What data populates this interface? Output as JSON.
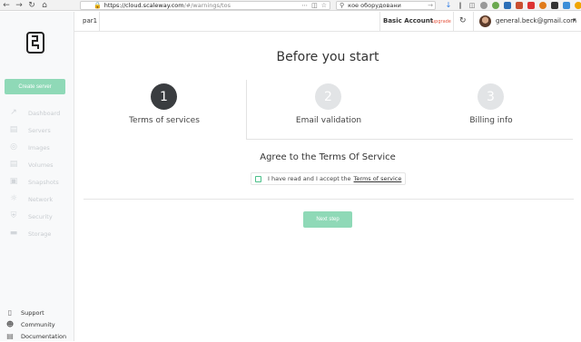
{
  "browser": {
    "url_host": "https://cloud.scaleway.com",
    "url_path": "/#/warnings/tos",
    "search_text": "кое оборудовани",
    "icons": [
      "back-icon",
      "forward-icon",
      "reload-icon",
      "home-icon",
      "download-icon",
      "library-icon",
      "sidebar-icon"
    ]
  },
  "sidebar": {
    "create_label": "Create server",
    "items": [
      {
        "label": "Dashboard",
        "icon": "chart-line-icon"
      },
      {
        "label": "Servers",
        "icon": "server-icon"
      },
      {
        "label": "Images",
        "icon": "disc-icon"
      },
      {
        "label": "Volumes",
        "icon": "volume-icon"
      },
      {
        "label": "Snapshots",
        "icon": "camera-icon"
      },
      {
        "label": "Network",
        "icon": "network-icon"
      },
      {
        "label": "Security",
        "icon": "shield-icon"
      },
      {
        "label": "Storage",
        "icon": "storage-icon"
      }
    ],
    "footer": [
      {
        "label": "Support",
        "icon": "chat-icon"
      },
      {
        "label": "Community",
        "icon": "users-icon"
      },
      {
        "label": "Documentation",
        "icon": "book-icon"
      }
    ]
  },
  "header": {
    "org": "par1",
    "account": "Basic Account",
    "upgrade": "upgrade",
    "email": "general.beck@gmail.com"
  },
  "main": {
    "title": "Before you start",
    "steps": [
      {
        "num": "1",
        "label": "Terms of services"
      },
      {
        "num": "2",
        "label": "Email validation"
      },
      {
        "num": "3",
        "label": "Billing info"
      }
    ],
    "agree_title": "Agree to the Terms Of Service",
    "checkbox_text": "I have read and I accept the",
    "tos_link": "Terms of service",
    "next_label": "Next step"
  },
  "colors": {
    "accent": "#8fd9b7",
    "active_step": "#3a3d40",
    "inactive_step": "#e2e4e6",
    "upgrade": "#e5533d"
  }
}
